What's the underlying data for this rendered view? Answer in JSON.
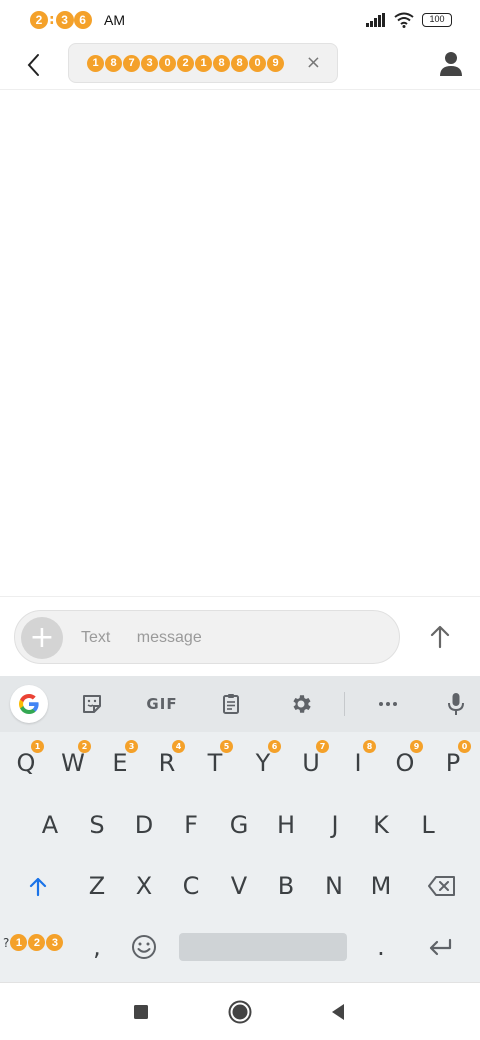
{
  "status_bar": {
    "time_digits": [
      "2",
      "3",
      "6"
    ],
    "time_separator": ":",
    "ampm": "AM",
    "battery": "100"
  },
  "header": {
    "recipient_digits": [
      "1",
      "8",
      "7",
      "3",
      "0",
      "2",
      "1",
      "8",
      "8",
      "0",
      "9"
    ],
    "clear_glyph": "×"
  },
  "compose": {
    "placeholder": "Text message",
    "attach_glyph": "+"
  },
  "keyboard": {
    "toolbar": {
      "gif": "GIF"
    },
    "row1": [
      {
        "key": "Q",
        "hint": "1"
      },
      {
        "key": "W",
        "hint": "2"
      },
      {
        "key": "E",
        "hint": "3"
      },
      {
        "key": "R",
        "hint": "4"
      },
      {
        "key": "T",
        "hint": "5"
      },
      {
        "key": "Y",
        "hint": "6"
      },
      {
        "key": "U",
        "hint": "7"
      },
      {
        "key": "I",
        "hint": "8"
      },
      {
        "key": "O",
        "hint": "9"
      },
      {
        "key": "P",
        "hint": "0"
      }
    ],
    "row2": [
      "A",
      "S",
      "D",
      "F",
      "G",
      "H",
      "J",
      "K",
      "L"
    ],
    "row3": [
      "Z",
      "X",
      "C",
      "V",
      "B",
      "N",
      "M"
    ],
    "row4": {
      "symbol_prefix": "?",
      "symbol_digits": [
        "1",
        "2",
        "3"
      ],
      "comma": ",",
      "period": "."
    }
  },
  "colors": {
    "accent_orange": "#f4a12a",
    "shift_blue": "#1a73e8",
    "keyboard_bg": "#eceff1"
  },
  "icons": {
    "back": "chevron-left-icon",
    "contact": "person-icon",
    "send": "arrow-up-icon",
    "google": "google-g-icon",
    "sticker": "sticker-icon",
    "clipboard": "clipboard-icon",
    "settings": "gear-icon",
    "more": "more-horizontal-icon",
    "mic": "microphone-icon",
    "shift": "shift-arrow-icon",
    "backspace": "backspace-icon",
    "emoji": "emoji-icon",
    "enter": "enter-icon",
    "recents": "square-icon",
    "home": "circle-icon",
    "nav_back": "triangle-back-icon"
  }
}
